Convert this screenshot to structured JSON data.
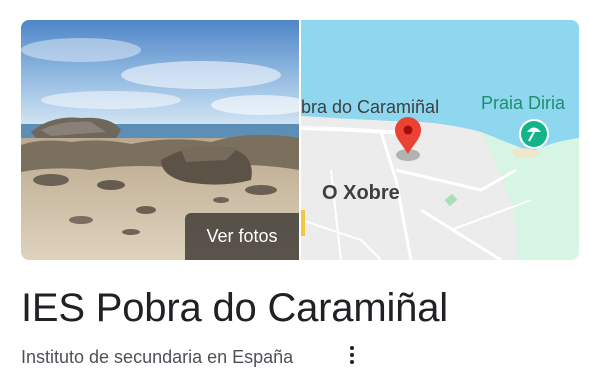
{
  "photo": {
    "button_label": "Ver fotos"
  },
  "map": {
    "place_label": "O Xobre",
    "street_label": "bra do Caramiñal",
    "beach_label": "Praia Diria"
  },
  "place": {
    "title": "IES Pobra do Caramiñal",
    "category": "Instituto de secundaria en España"
  }
}
